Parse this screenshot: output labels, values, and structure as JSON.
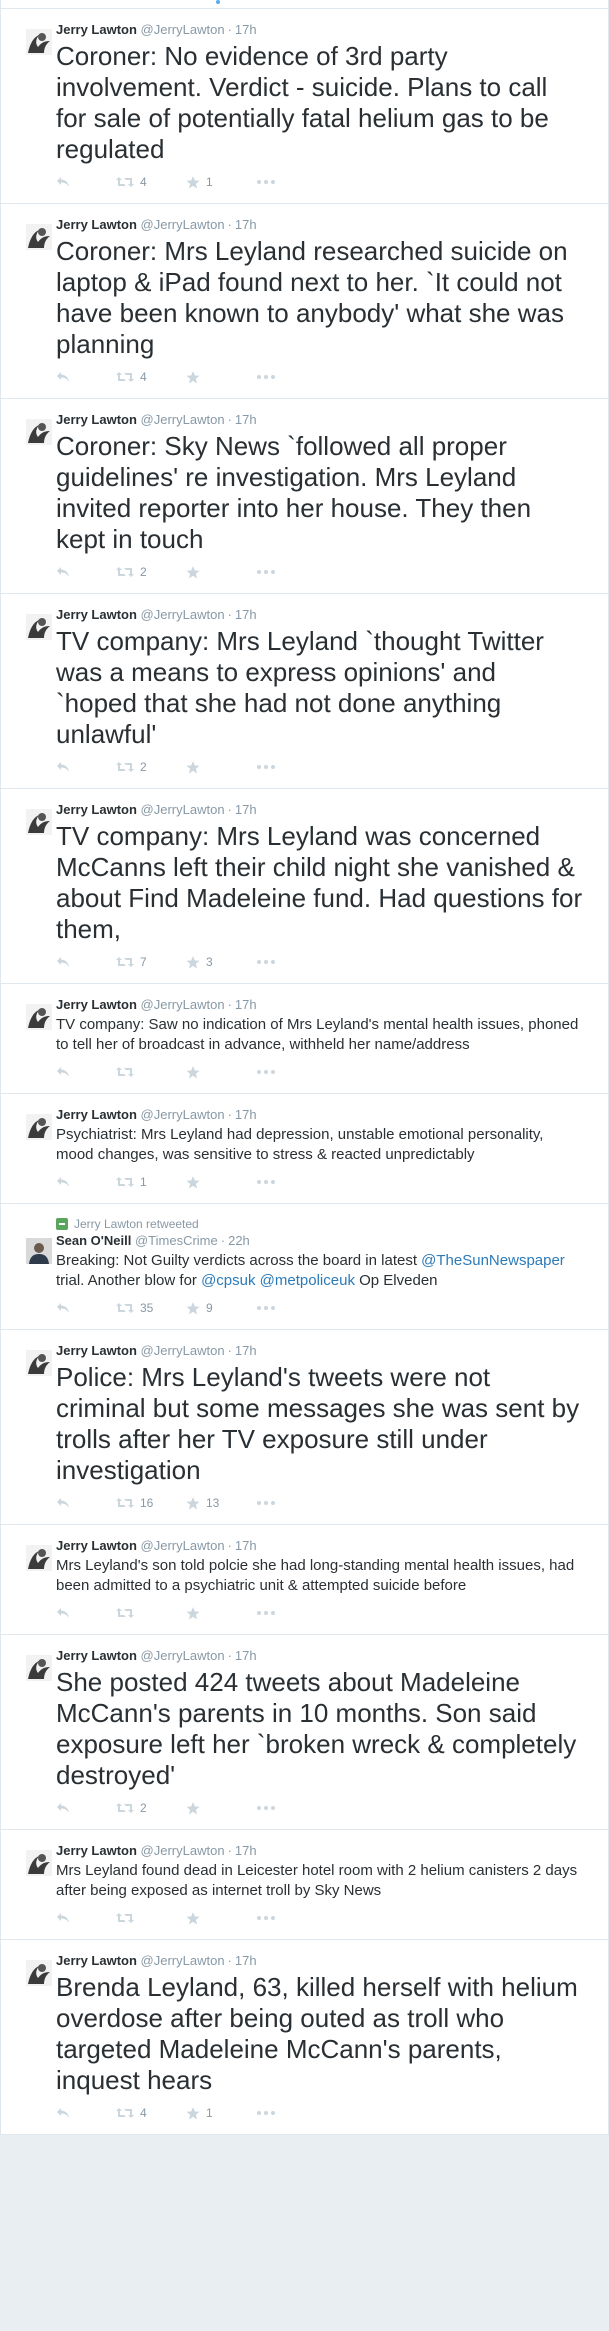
{
  "tweets": [
    {
      "name": "Jerry Lawton",
      "handle": "@JerryLawton",
      "time": "17h",
      "size": "large",
      "segments": [
        {
          "text": "Coroner: No evidence of 3rd party involvement. Verdict - suicide. Plans to call for sale of potentially fatal helium gas to be regulated"
        }
      ],
      "retweets": "4",
      "favorites": "1"
    },
    {
      "name": "Jerry Lawton",
      "handle": "@JerryLawton",
      "time": "17h",
      "size": "large",
      "segments": [
        {
          "text": "Coroner: Mrs Leyland researched suicide on laptop & iPad found next to her. `It could not have been known to anybody' what she was planning"
        }
      ],
      "retweets": "4",
      "favorites": ""
    },
    {
      "name": "Jerry Lawton",
      "handle": "@JerryLawton",
      "time": "17h",
      "size": "large",
      "segments": [
        {
          "text": "Coroner: Sky News `followed all proper guidelines' re investigation. Mrs Leyland invited reporter into her house. They then kept in touch"
        }
      ],
      "retweets": "2",
      "favorites": ""
    },
    {
      "name": "Jerry Lawton",
      "handle": "@JerryLawton",
      "time": "17h",
      "size": "large",
      "segments": [
        {
          "text": "TV company: Mrs Leyland `thought Twitter was a means to express opinions' and `hoped that she had not done anything unlawful'"
        }
      ],
      "retweets": "2",
      "favorites": ""
    },
    {
      "name": "Jerry Lawton",
      "handle": "@JerryLawton",
      "time": "17h",
      "size": "large",
      "segments": [
        {
          "text": "TV company: Mrs Leyland was concerned McCanns left their child night she vanished & about Find Madeleine fund. Had questions for them,"
        }
      ],
      "retweets": "7",
      "favorites": "3"
    },
    {
      "name": "Jerry Lawton",
      "handle": "@JerryLawton",
      "time": "17h",
      "size": "small",
      "segments": [
        {
          "text": "TV company: Saw no indication of Mrs Leyland's mental health issues, phoned to tell her of broadcast in advance, withheld her name/address"
        }
      ],
      "retweets": "",
      "favorites": ""
    },
    {
      "name": "Jerry Lawton",
      "handle": "@JerryLawton",
      "time": "17h",
      "size": "small",
      "segments": [
        {
          "text": "Psychiatrist: Mrs Leyland had depression, unstable emotional personality, mood changes, was sensitive to stress & reacted unpredictably"
        }
      ],
      "retweets": "1",
      "favorites": ""
    },
    {
      "name": "Sean O'Neill",
      "handle": "@TimesCrime",
      "time": "22h",
      "size": "small",
      "retweeted_by": "Jerry Lawton retweeted",
      "segments": [
        {
          "text": "Breaking: Not Guilty verdicts across the board in latest "
        },
        {
          "text": "@TheSunNewspaper",
          "link": true
        },
        {
          "text": " trial. Another blow for "
        },
        {
          "text": "@cpsuk",
          "link": true
        },
        {
          "text": " "
        },
        {
          "text": "@metpoliceuk",
          "link": true
        },
        {
          "text": " Op Elveden"
        }
      ],
      "retweets": "35",
      "favorites": "9"
    },
    {
      "name": "Jerry Lawton",
      "handle": "@JerryLawton",
      "time": "17h",
      "size": "large",
      "segments": [
        {
          "text": "Police: Mrs Leyland's tweets were not criminal but some messages she was sent by trolls after her TV exposure still under investigation"
        }
      ],
      "retweets": "16",
      "favorites": "13"
    },
    {
      "name": "Jerry Lawton",
      "handle": "@JerryLawton",
      "time": "17h",
      "size": "small",
      "segments": [
        {
          "text": "Mrs Leyland's son told polcie she had long-standing mental health issues, had been admitted to a psychiatric unit & attempted suicide before"
        }
      ],
      "retweets": "",
      "favorites": ""
    },
    {
      "name": "Jerry Lawton",
      "handle": "@JerryLawton",
      "time": "17h",
      "size": "large",
      "segments": [
        {
          "text": "She posted 424 tweets about Madeleine McCann's parents in 10 months. Son said exposure left her `broken wreck & completely destroyed'"
        }
      ],
      "retweets": "2",
      "favorites": ""
    },
    {
      "name": "Jerry Lawton",
      "handle": "@JerryLawton",
      "time": "17h",
      "size": "small",
      "segments": [
        {
          "text": "Mrs Leyland found dead in Leicester hotel room with 2 helium canisters 2 days after being exposed as internet troll by Sky News"
        }
      ],
      "retweets": "",
      "favorites": ""
    },
    {
      "name": "Jerry Lawton",
      "handle": "@JerryLawton",
      "time": "17h",
      "size": "large",
      "segments": [
        {
          "text": "Brenda Leyland, 63, killed herself with helium overdose after being outed as troll who targeted Madeleine McCann's parents, inquest hears"
        }
      ],
      "retweets": "4",
      "favorites": "1"
    }
  ],
  "icons": {
    "reply": "reply-icon",
    "retweet": "retweet-icon",
    "favorite": "star-icon",
    "more": "more-icon"
  },
  "colors": {
    "link": "#2b7bb9",
    "meta": "#8899a6",
    "text": "#292f33",
    "retweet_badge": "#5ba45b"
  }
}
